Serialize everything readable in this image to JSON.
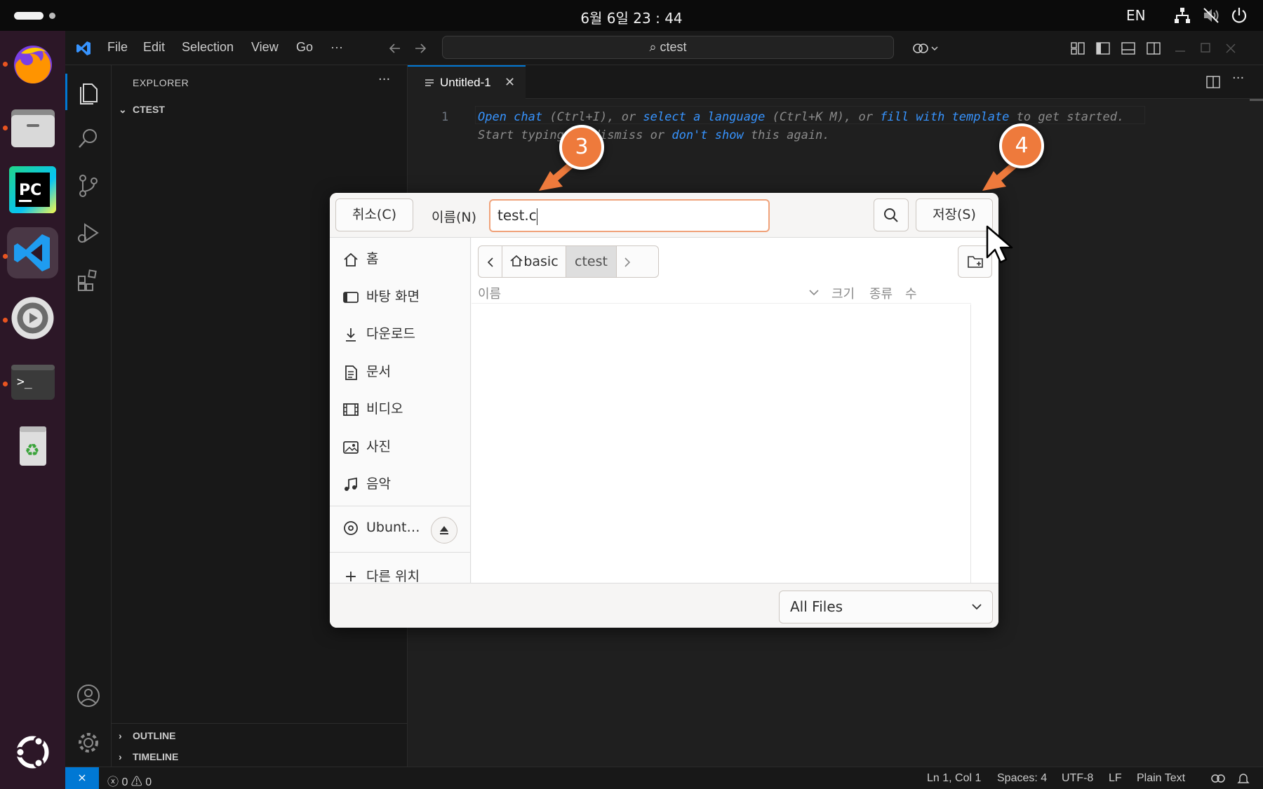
{
  "topbar": {
    "clock": "6월 6일  23 : 44",
    "language": "EN"
  },
  "dock": {
    "apps": [
      "firefox-icon",
      "files-icon",
      "pycharm-icon",
      "vscode-icon",
      "settings-icon",
      "terminal-icon",
      "trash-icon",
      "ubuntu-icon"
    ]
  },
  "vscode": {
    "menu": [
      "File",
      "Edit",
      "Selection",
      "View",
      "Go",
      "···"
    ],
    "command_center": "ctest",
    "explorer": {
      "title": "EXPLORER",
      "more": "···",
      "folder": "CTEST",
      "outline": "OUTLINE",
      "timeline": "TIMELINE"
    },
    "tab": {
      "label": "Untitled-1",
      "close": "✕"
    },
    "editor": {
      "line_number": "1",
      "hint_line1": {
        "link1": "Open chat",
        "t1": " (Ctrl+I), or ",
        "link2": "select a language",
        "t2": " (Ctrl+K M), or ",
        "link3": "fill with template",
        "t3": " to get started."
      },
      "hint_line2": {
        "t1": "Start typing to dismiss or ",
        "link1": "don't show",
        "t2": " this again."
      }
    },
    "status": {
      "remote": "⨯",
      "problems": "ⓧ 0 ⚠ 0",
      "position": "Ln 1, Col 1",
      "spaces": "Spaces: 4",
      "encoding": "UTF-8",
      "eol": "LF",
      "language": "Plain Text"
    }
  },
  "dialog": {
    "cancel": "취소(C)",
    "name_label": "이름(N)",
    "filename": "test.c",
    "save": "저장(S)",
    "places": [
      {
        "label": "홈",
        "icon": "home-icon"
      },
      {
        "label": "바탕 화면",
        "icon": "desktop-icon"
      },
      {
        "label": "다운로드",
        "icon": "download-icon"
      },
      {
        "label": "문서",
        "icon": "document-icon"
      },
      {
        "label": "비디오",
        "icon": "video-icon"
      },
      {
        "label": "사진",
        "icon": "picture-icon"
      },
      {
        "label": "음악",
        "icon": "music-icon"
      }
    ],
    "drive": "Ubunt…",
    "other_locations": "다른 위치",
    "path": [
      "basic",
      "ctest"
    ],
    "columns": {
      "name": "이름",
      "size": "크기",
      "type": "종류",
      "modified": "수"
    },
    "filter": "All Files"
  },
  "annotations": {
    "step3": "3",
    "step4": "4",
    "color": "#ee7a3c"
  }
}
